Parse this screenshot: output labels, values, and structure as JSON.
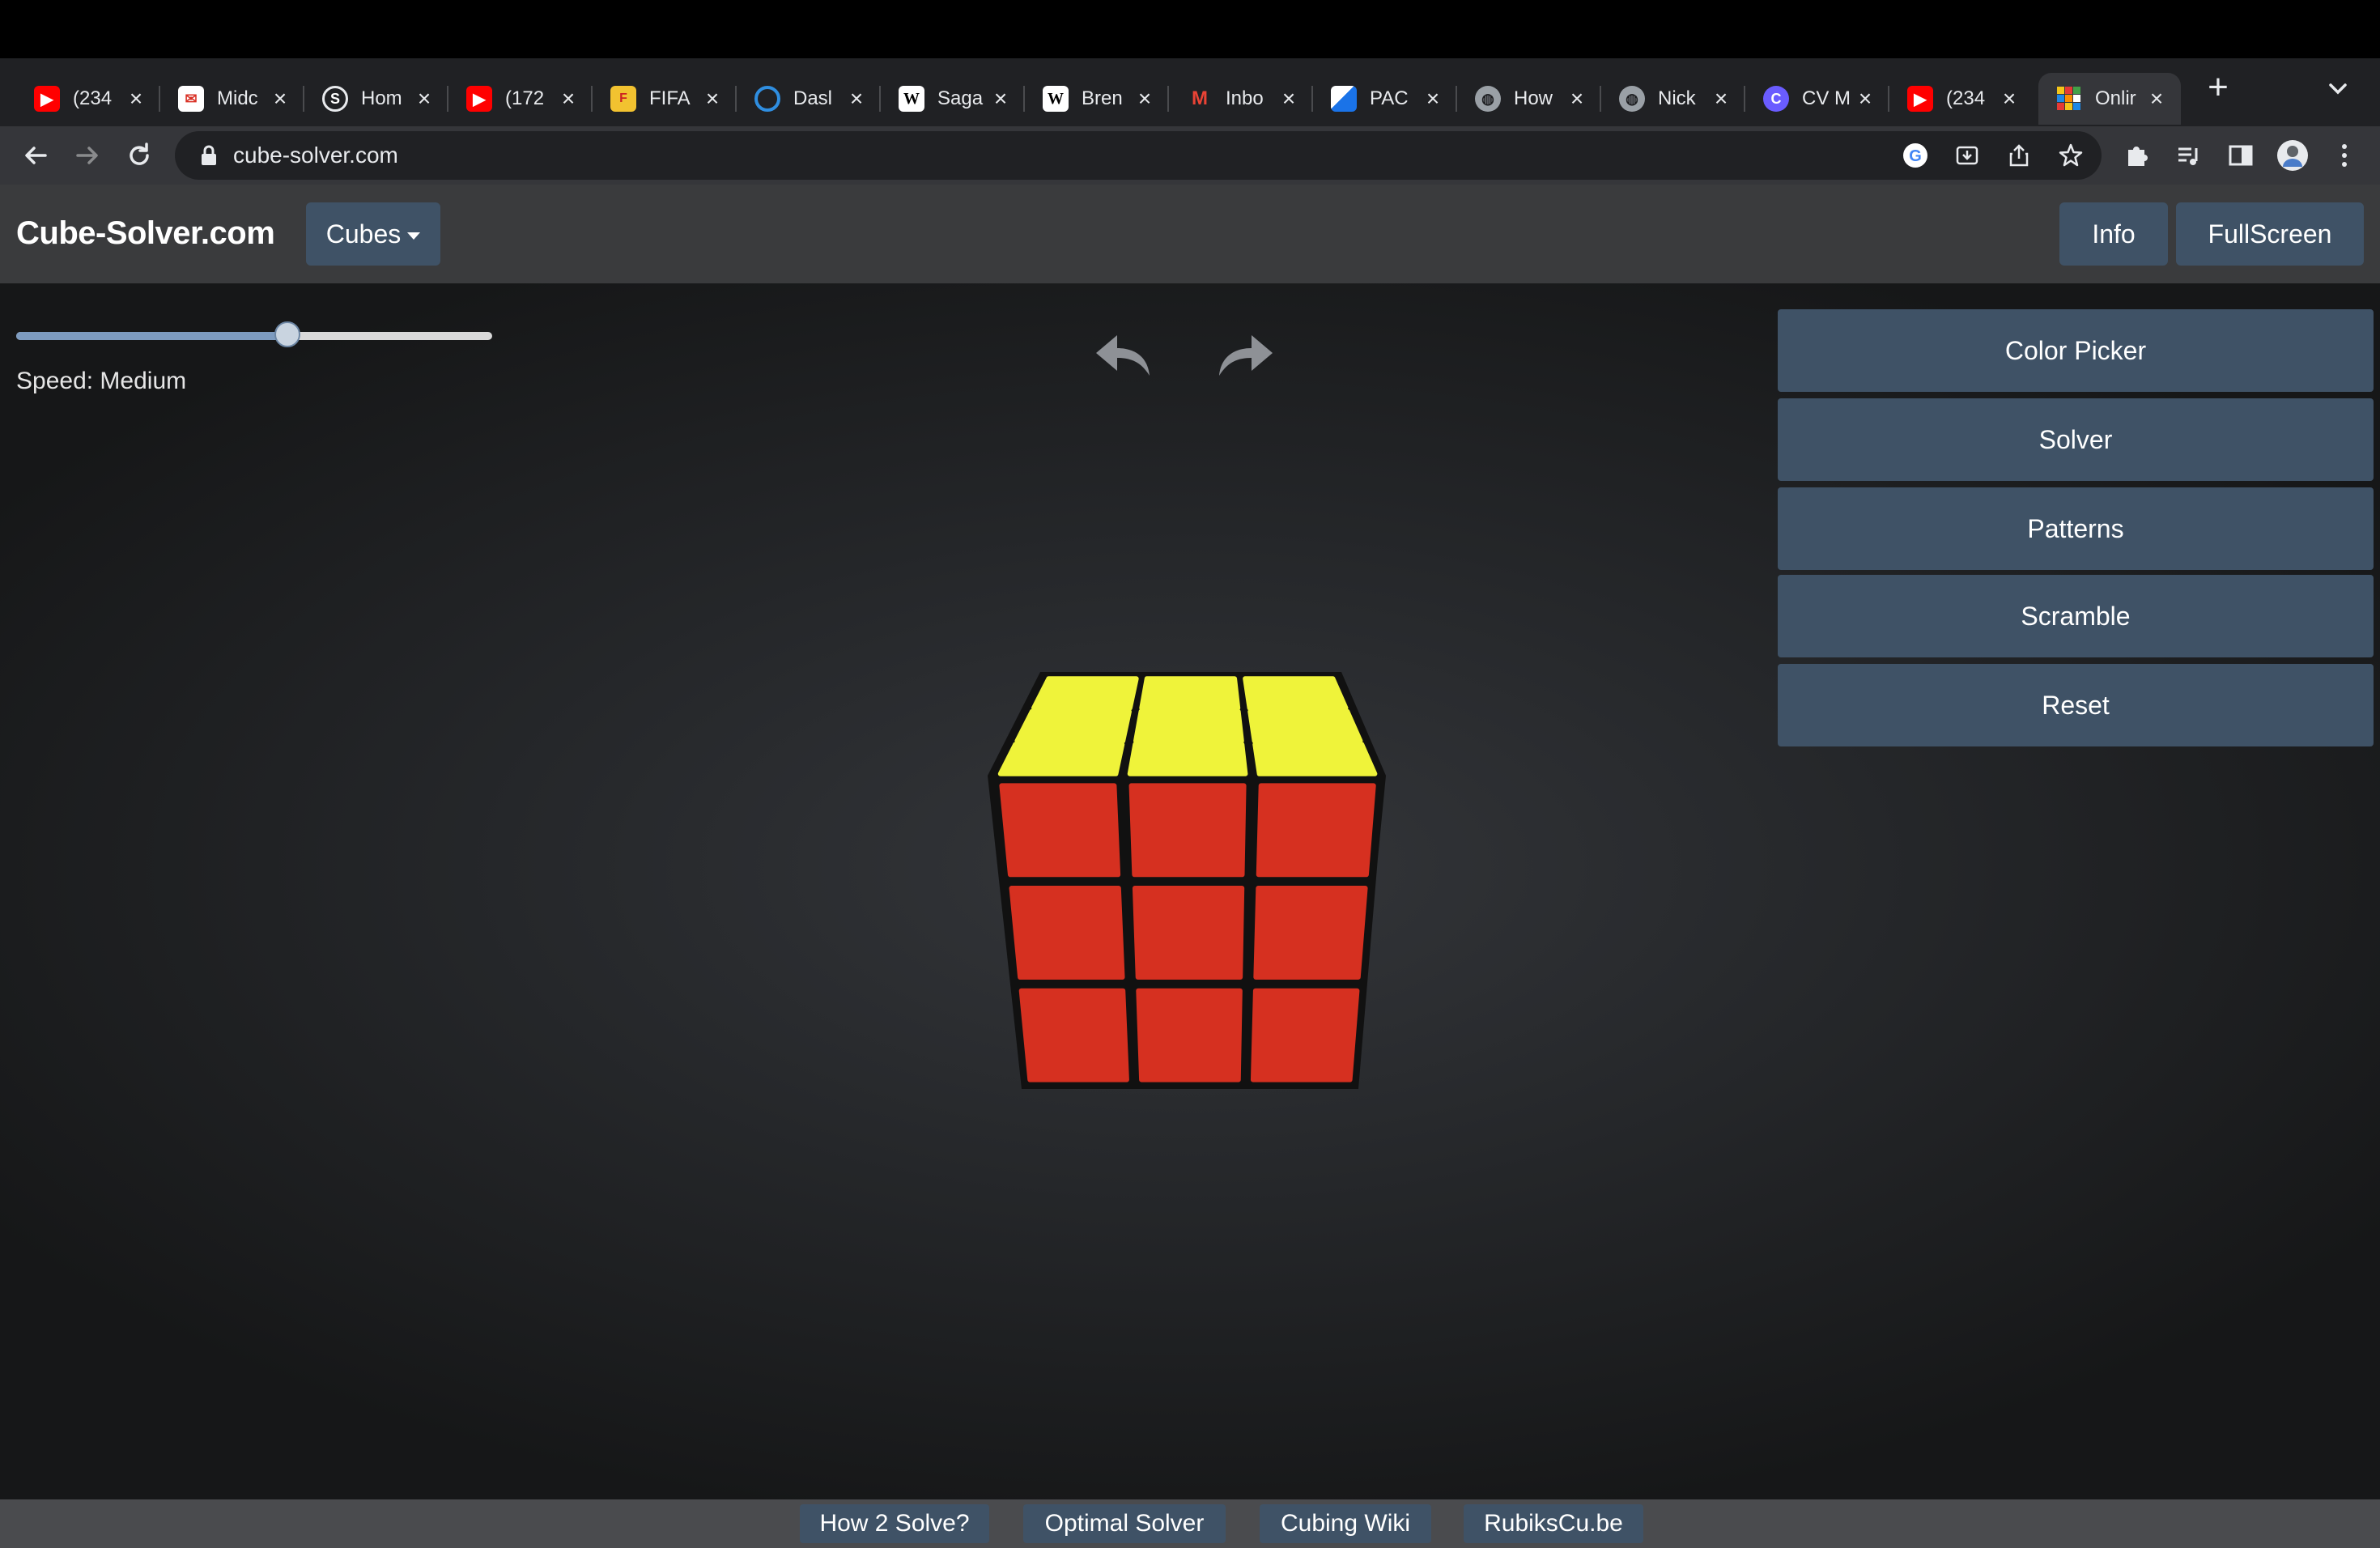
{
  "browser": {
    "tabs": [
      {
        "title": "(234",
        "favicon": "youtube-icon",
        "color": "#ff0000"
      },
      {
        "title": "Midc",
        "favicon": "mail-envelope-icon",
        "color": "#d93025"
      },
      {
        "title": "Hom",
        "favicon": "s-circle-icon",
        "color": "#202124"
      },
      {
        "title": "(172",
        "favicon": "youtube-icon",
        "color": "#ff0000"
      },
      {
        "title": "FIFA",
        "favicon": "fifa-game-icon",
        "color": "#f2c230"
      },
      {
        "title": "Dasl",
        "favicon": "ring-icon",
        "color": "#2f8ee0"
      },
      {
        "title": "Saga",
        "favicon": "wikipedia-icon",
        "color": "#ffffff"
      },
      {
        "title": "Bren",
        "favicon": "wikipedia-icon",
        "color": "#ffffff"
      },
      {
        "title": "Inbo",
        "favicon": "gmail-icon",
        "color": "#ea4335"
      },
      {
        "title": "PAC",
        "favicon": "pac-flag-icon",
        "color": "#1a73e8"
      },
      {
        "title": "How",
        "favicon": "globe-icon",
        "color": "#9aa0a6"
      },
      {
        "title": "Nick",
        "favicon": "globe-icon",
        "color": "#9aa0a6"
      },
      {
        "title": "CV M",
        "favicon": "c-logo-icon",
        "color": "#6a5cff"
      },
      {
        "title": "(234",
        "favicon": "youtube-icon",
        "color": "#ff0000"
      },
      {
        "title": "Onlir",
        "favicon": "rubiks-cube-icon",
        "color": "#f5c518",
        "active": true
      }
    ],
    "url": "cube-solver.com"
  },
  "site": {
    "brand": "Cube-Solver.com",
    "cubes_menu": "Cubes",
    "info_button": "Info",
    "fullscreen_button": "FullScreen"
  },
  "controls": {
    "speed_label": "Speed: Medium",
    "speed_value_fraction": 0.57
  },
  "panel": {
    "buttons": [
      "Color Picker",
      "Solver",
      "Patterns",
      "Scramble",
      "Reset"
    ]
  },
  "cube": {
    "top_color": "#eff33a",
    "front_color": "#d63020",
    "body_color": "#111111"
  },
  "footer": {
    "links": [
      "How 2 Solve?",
      "Optimal Solver",
      "Cubing Wiki",
      "RubiksCu.be"
    ]
  },
  "colors": {
    "button_bg": "#3f5266",
    "header_bg": "#3a3b3d"
  }
}
